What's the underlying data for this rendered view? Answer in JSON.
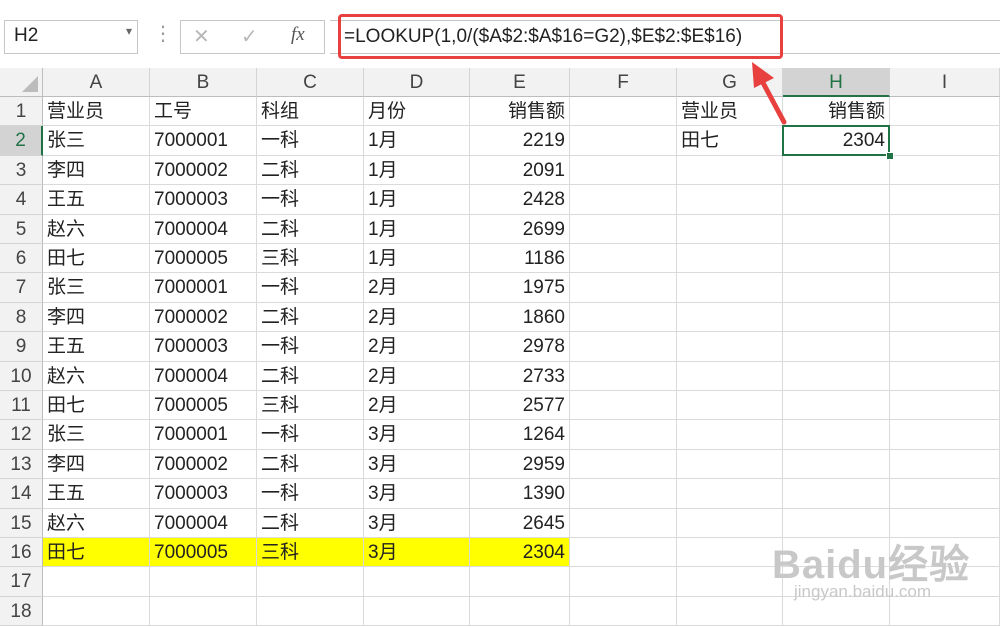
{
  "formula_bar": {
    "name_box": "H2",
    "fx_label": "fx",
    "formula": "=LOOKUP(1,0/($A$2:$A$16=G2),$E$2:$E$16)"
  },
  "columns": [
    "A",
    "B",
    "C",
    "D",
    "E",
    "F",
    "G",
    "H",
    "I"
  ],
  "selected_column": "H",
  "row_numbers": [
    "1",
    "2",
    "3",
    "4",
    "5",
    "6",
    "7",
    "8",
    "9",
    "10",
    "11",
    "12",
    "13",
    "14",
    "15",
    "16",
    "17",
    "18"
  ],
  "selected_row": "2",
  "table": {
    "headers": [
      "营业员",
      "工号",
      "科组",
      "月份",
      "销售额"
    ],
    "rows": [
      [
        "张三",
        "7000001",
        "一科",
        "1月",
        "2219"
      ],
      [
        "李四",
        "7000002",
        "二科",
        "1月",
        "2091"
      ],
      [
        "王五",
        "7000003",
        "一科",
        "1月",
        "2428"
      ],
      [
        "赵六",
        "7000004",
        "二科",
        "1月",
        "2699"
      ],
      [
        "田七",
        "7000005",
        "三科",
        "1月",
        "1186"
      ],
      [
        "张三",
        "7000001",
        "一科",
        "2月",
        "1975"
      ],
      [
        "李四",
        "7000002",
        "二科",
        "2月",
        "1860"
      ],
      [
        "王五",
        "7000003",
        "一科",
        "2月",
        "2978"
      ],
      [
        "赵六",
        "7000004",
        "二科",
        "2月",
        "2733"
      ],
      [
        "田七",
        "7000005",
        "三科",
        "2月",
        "2577"
      ],
      [
        "张三",
        "7000001",
        "一科",
        "3月",
        "1264"
      ],
      [
        "李四",
        "7000002",
        "二科",
        "3月",
        "2959"
      ],
      [
        "王五",
        "7000003",
        "一科",
        "3月",
        "1390"
      ],
      [
        "赵六",
        "7000004",
        "二科",
        "3月",
        "2645"
      ],
      [
        "田七",
        "7000005",
        "三科",
        "3月",
        "2304"
      ]
    ],
    "highlight_row": 15,
    "highlight_color": "#ffff00"
  },
  "lookup": {
    "g1": "营业员",
    "h1": "销售额",
    "g2": "田七",
    "h2": "2304"
  },
  "colors": {
    "accent": "#217346",
    "annotation": "#e8403f"
  },
  "watermark": {
    "logo": "Baidu经验",
    "url": "jingyan.baidu.com"
  }
}
